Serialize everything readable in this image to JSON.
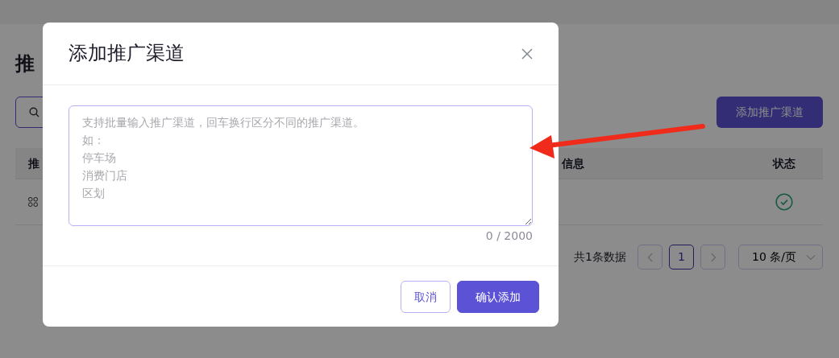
{
  "page": {
    "title": "推",
    "search": {
      "kind": "icon-field"
    },
    "add_button": "添加推广渠道",
    "table": {
      "columns": [
        "推",
        "信息",
        "状态"
      ],
      "rows": [
        {
          "enabled": true
        }
      ]
    },
    "pagination": {
      "total": "共1条数据",
      "pages": [
        {
          "label": "1",
          "selected": true
        }
      ],
      "page_size": "10 条/页"
    }
  },
  "modal": {
    "title": "添加推广渠道",
    "textarea": {
      "placeholder_lines": [
        "支持批量输入推广渠道，回车换行区分不同的推广渠道。",
        "如：",
        "停车场",
        "消费门店",
        "区划"
      ]
    },
    "counter": "0 / 2000",
    "buttons": [
      {
        "label": "取消",
        "kind": "secondary"
      },
      {
        "label": "确认添加",
        "kind": "primary"
      }
    ]
  }
}
